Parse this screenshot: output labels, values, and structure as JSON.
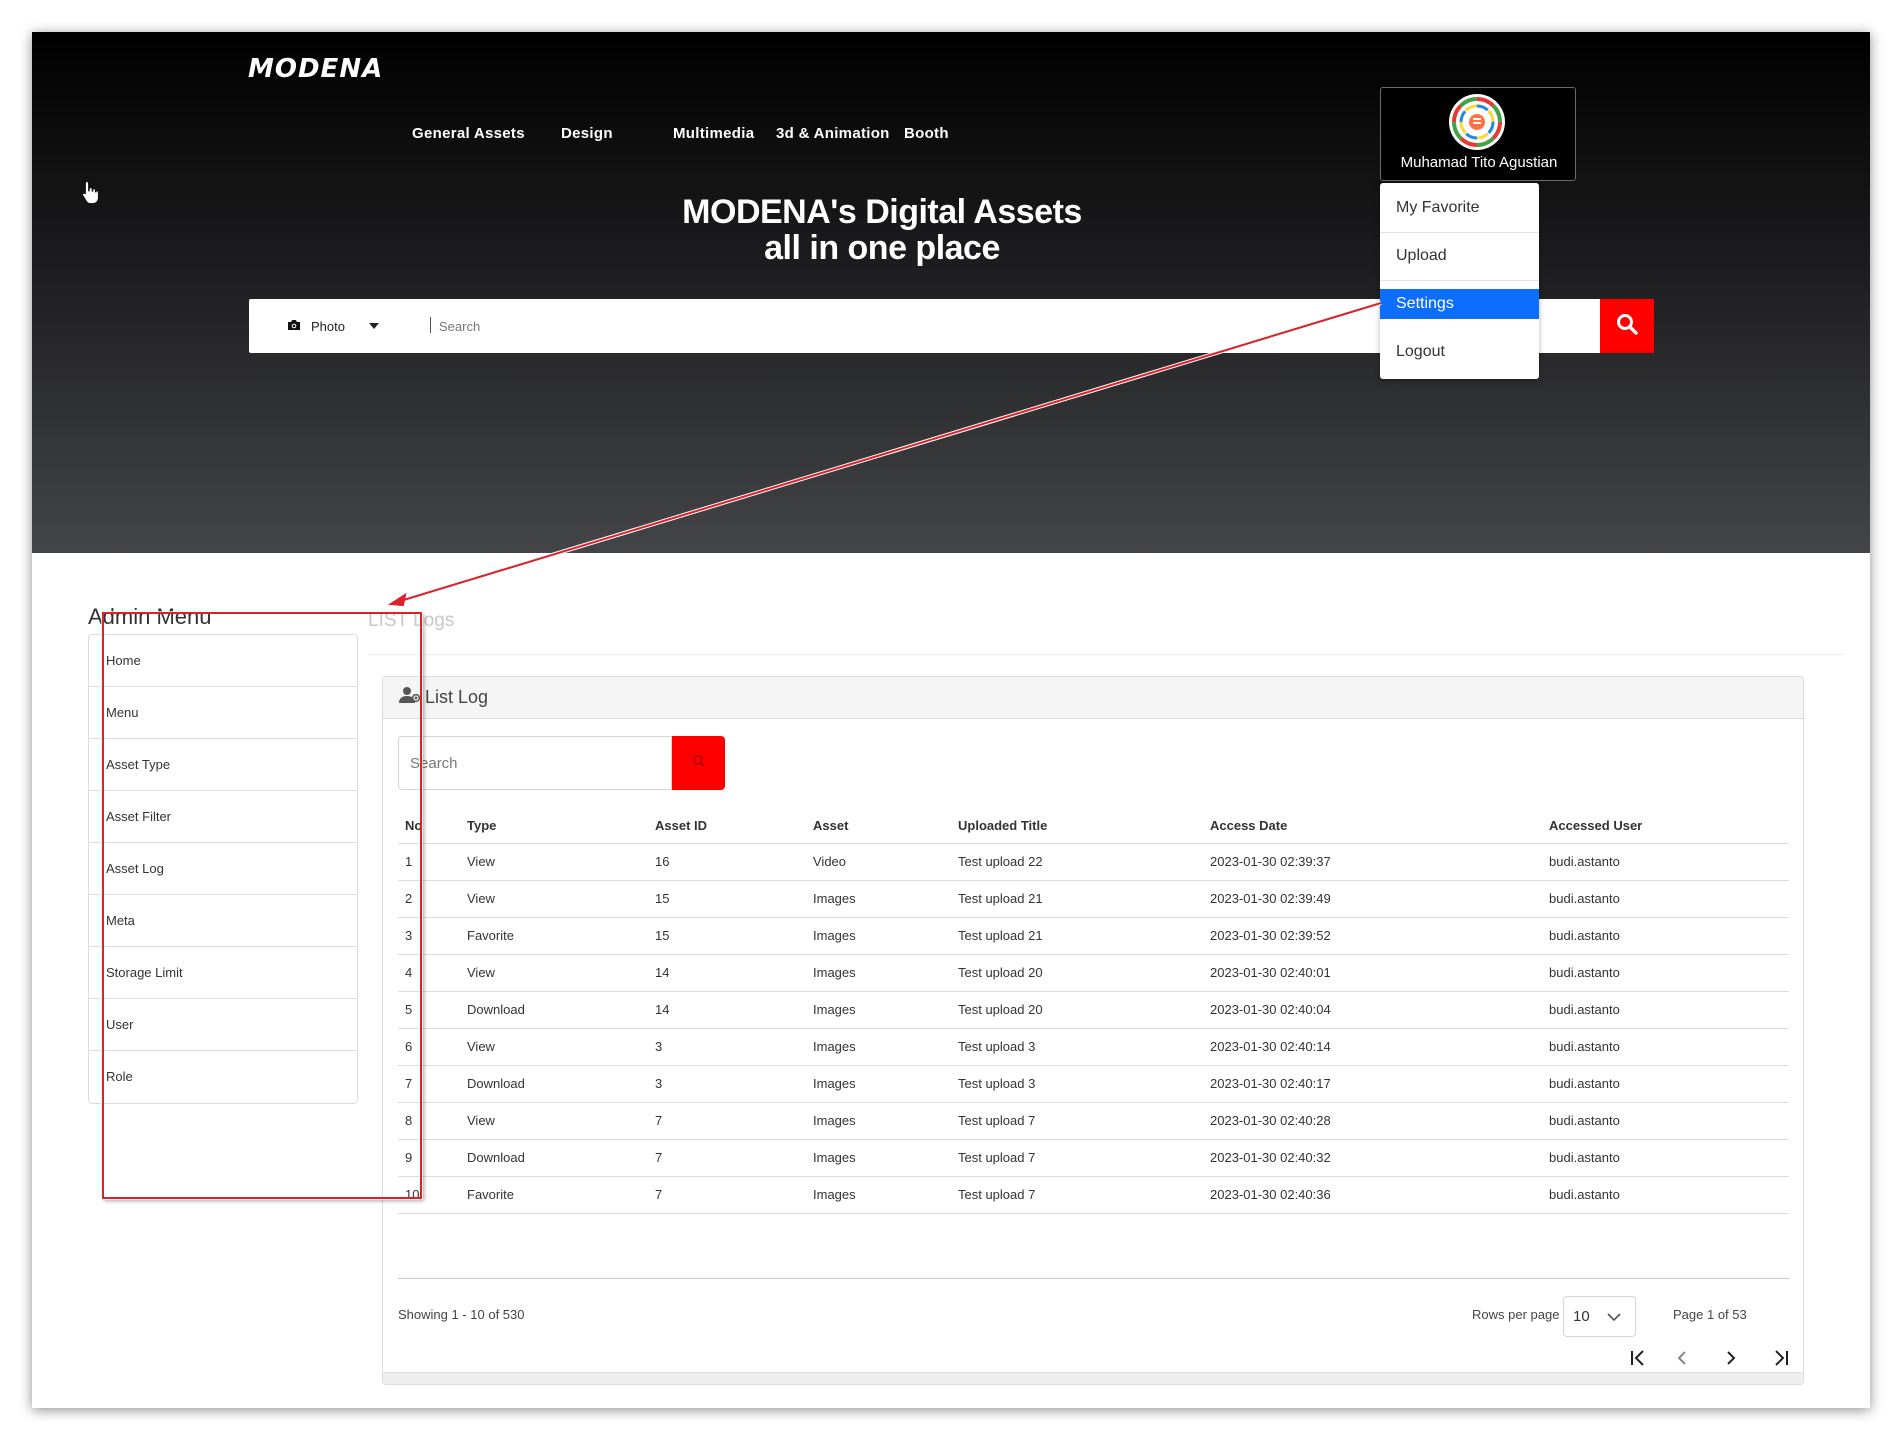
{
  "brand": {
    "logo": "MODENA"
  },
  "nav": [
    {
      "label": "General Assets"
    },
    {
      "label": "Design"
    },
    {
      "label": "Multimedia"
    },
    {
      "label": "3d & Animation"
    },
    {
      "label": "Booth"
    }
  ],
  "hero": {
    "title_line1": "MODENA's Digital Assets",
    "title_line2": "all in one place"
  },
  "search": {
    "type_label": "Photo",
    "placeholder": "Search"
  },
  "user": {
    "name": "Muhamad Tito Agustian"
  },
  "user_menu": [
    {
      "label": "My Favorite"
    },
    {
      "label": "Upload"
    },
    {
      "label": "Settings"
    },
    {
      "label": "Logout"
    }
  ],
  "sidebar": {
    "title": "Admin Menu",
    "items": [
      {
        "label": "Home"
      },
      {
        "label": "Menu"
      },
      {
        "label": "Asset Type"
      },
      {
        "label": "Asset Filter"
      },
      {
        "label": "Asset Log"
      },
      {
        "label": "Meta"
      },
      {
        "label": "Storage Limit"
      },
      {
        "label": "User"
      },
      {
        "label": "Role"
      }
    ]
  },
  "main": {
    "page_heading": "LIST Logs",
    "card_title": "List Log",
    "search_placeholder": "Search",
    "columns": [
      "No",
      "Type",
      "Asset ID",
      "Asset",
      "Uploaded Title",
      "Access Date",
      "Accessed User"
    ],
    "rows": [
      [
        "1",
        "View",
        "16",
        "Video",
        "Test upload 22",
        "2023-01-30 02:39:37",
        "budi.astanto"
      ],
      [
        "2",
        "View",
        "15",
        "Images",
        "Test upload 21",
        "2023-01-30 02:39:49",
        "budi.astanto"
      ],
      [
        "3",
        "Favorite",
        "15",
        "Images",
        "Test upload 21",
        "2023-01-30 02:39:52",
        "budi.astanto"
      ],
      [
        "4",
        "View",
        "14",
        "Images",
        "Test upload 20",
        "2023-01-30 02:40:01",
        "budi.astanto"
      ],
      [
        "5",
        "Download",
        "14",
        "Images",
        "Test upload 20",
        "2023-01-30 02:40:04",
        "budi.astanto"
      ],
      [
        "6",
        "View",
        "3",
        "Images",
        "Test upload 3",
        "2023-01-30 02:40:14",
        "budi.astanto"
      ],
      [
        "7",
        "Download",
        "3",
        "Images",
        "Test upload 3",
        "2023-01-30 02:40:17",
        "budi.astanto"
      ],
      [
        "8",
        "View",
        "7",
        "Images",
        "Test upload 7",
        "2023-01-30 02:40:28",
        "budi.astanto"
      ],
      [
        "9",
        "Download",
        "7",
        "Images",
        "Test upload 7",
        "2023-01-30 02:40:32",
        "budi.astanto"
      ],
      [
        "10",
        "Favorite",
        "7",
        "Images",
        "Test upload 7",
        "2023-01-30 02:40:36",
        "budi.astanto"
      ]
    ],
    "pagination": {
      "showing": "Showing 1 - 10 of 530",
      "rows_per_page_label": "Rows per page",
      "rows_per_page": "10",
      "page_info": "Page 1 of 53"
    }
  },
  "colors": {
    "accent_red": "#ff0000",
    "active_blue": "#0d6efd",
    "annotation_red": "#d9222a"
  },
  "icons": [
    "camera-icon",
    "chevron-down-icon",
    "search-icon",
    "user-icon",
    "first-page-icon",
    "prev-page-icon",
    "next-page-icon",
    "last-page-icon",
    "mouse-cursor-icon"
  ]
}
